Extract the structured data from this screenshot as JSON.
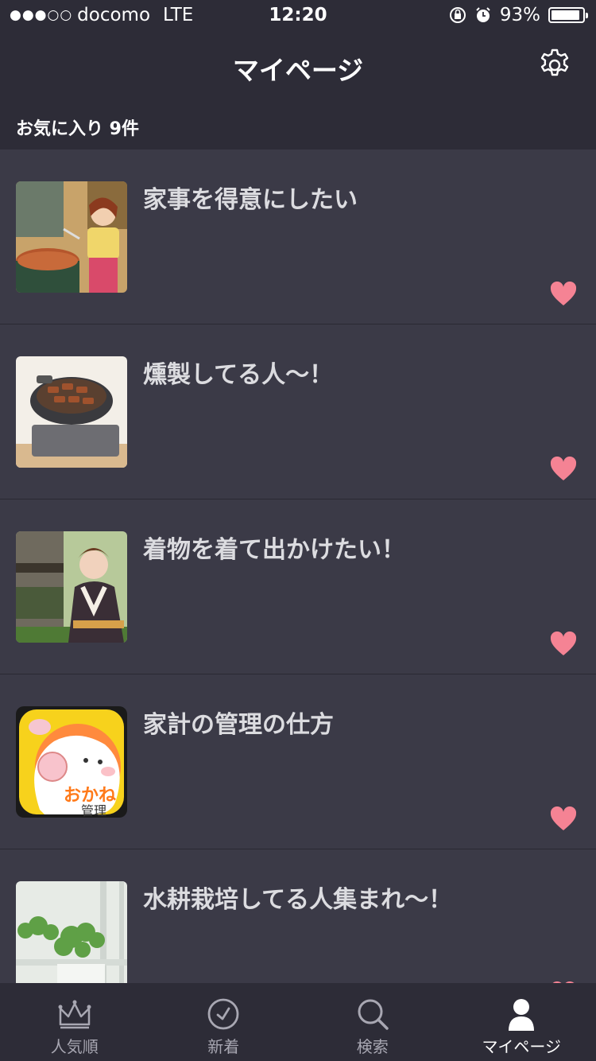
{
  "status_bar": {
    "carrier": "docomo",
    "network": "LTE",
    "time": "12:20",
    "battery": "93%",
    "battery_level": 0.93,
    "signal_bars": 3,
    "signal_total": 5
  },
  "header": {
    "title": "マイページ",
    "settings_icon": "gear-icon"
  },
  "favorites": {
    "label": "お気に入り 9件"
  },
  "items": [
    {
      "title": "家事を得意にしたい",
      "thumb": "anime-cooking-image"
    },
    {
      "title": "燻製してる人〜！",
      "thumb": "grill-image"
    },
    {
      "title": "着物を着て出かけたい！",
      "thumb": "kimono-image"
    },
    {
      "title": "家計の管理の仕方",
      "thumb": "money-app-icon-image"
    },
    {
      "title": "水耕栽培してる人集まれ〜！",
      "thumb": "hydroponics-image"
    }
  ],
  "thumb_text": {
    "okane": "おかね",
    "kanri": "管理"
  },
  "tabs": [
    {
      "label": "人気順",
      "icon": "crown-icon"
    },
    {
      "label": "新着",
      "icon": "clock-icon"
    },
    {
      "label": "検索",
      "icon": "search-icon"
    },
    {
      "label": "マイページ",
      "icon": "person-icon"
    }
  ],
  "colors": {
    "background": "#3b3a47",
    "bar": "#2d2c37",
    "heart": "#f58394",
    "text": "#ffffff"
  }
}
